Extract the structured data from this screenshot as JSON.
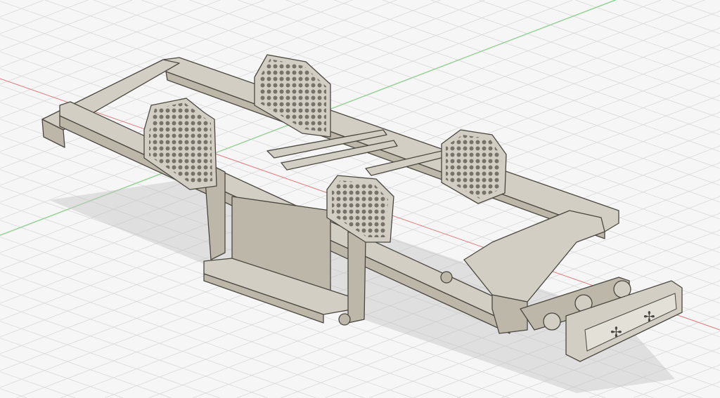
{
  "viewport": {
    "background": "#f6f6f6",
    "grid_color": "#d9d9d9",
    "x_axis_color": "#e07a7a",
    "y_axis_color": "#7ccf7c",
    "model_light": "#d3cec3",
    "model_mid": "#bdb7aa",
    "model_dark": "#8f897d",
    "hole_color": "#6d685f",
    "shadow_color": "#c4c4c4"
  }
}
